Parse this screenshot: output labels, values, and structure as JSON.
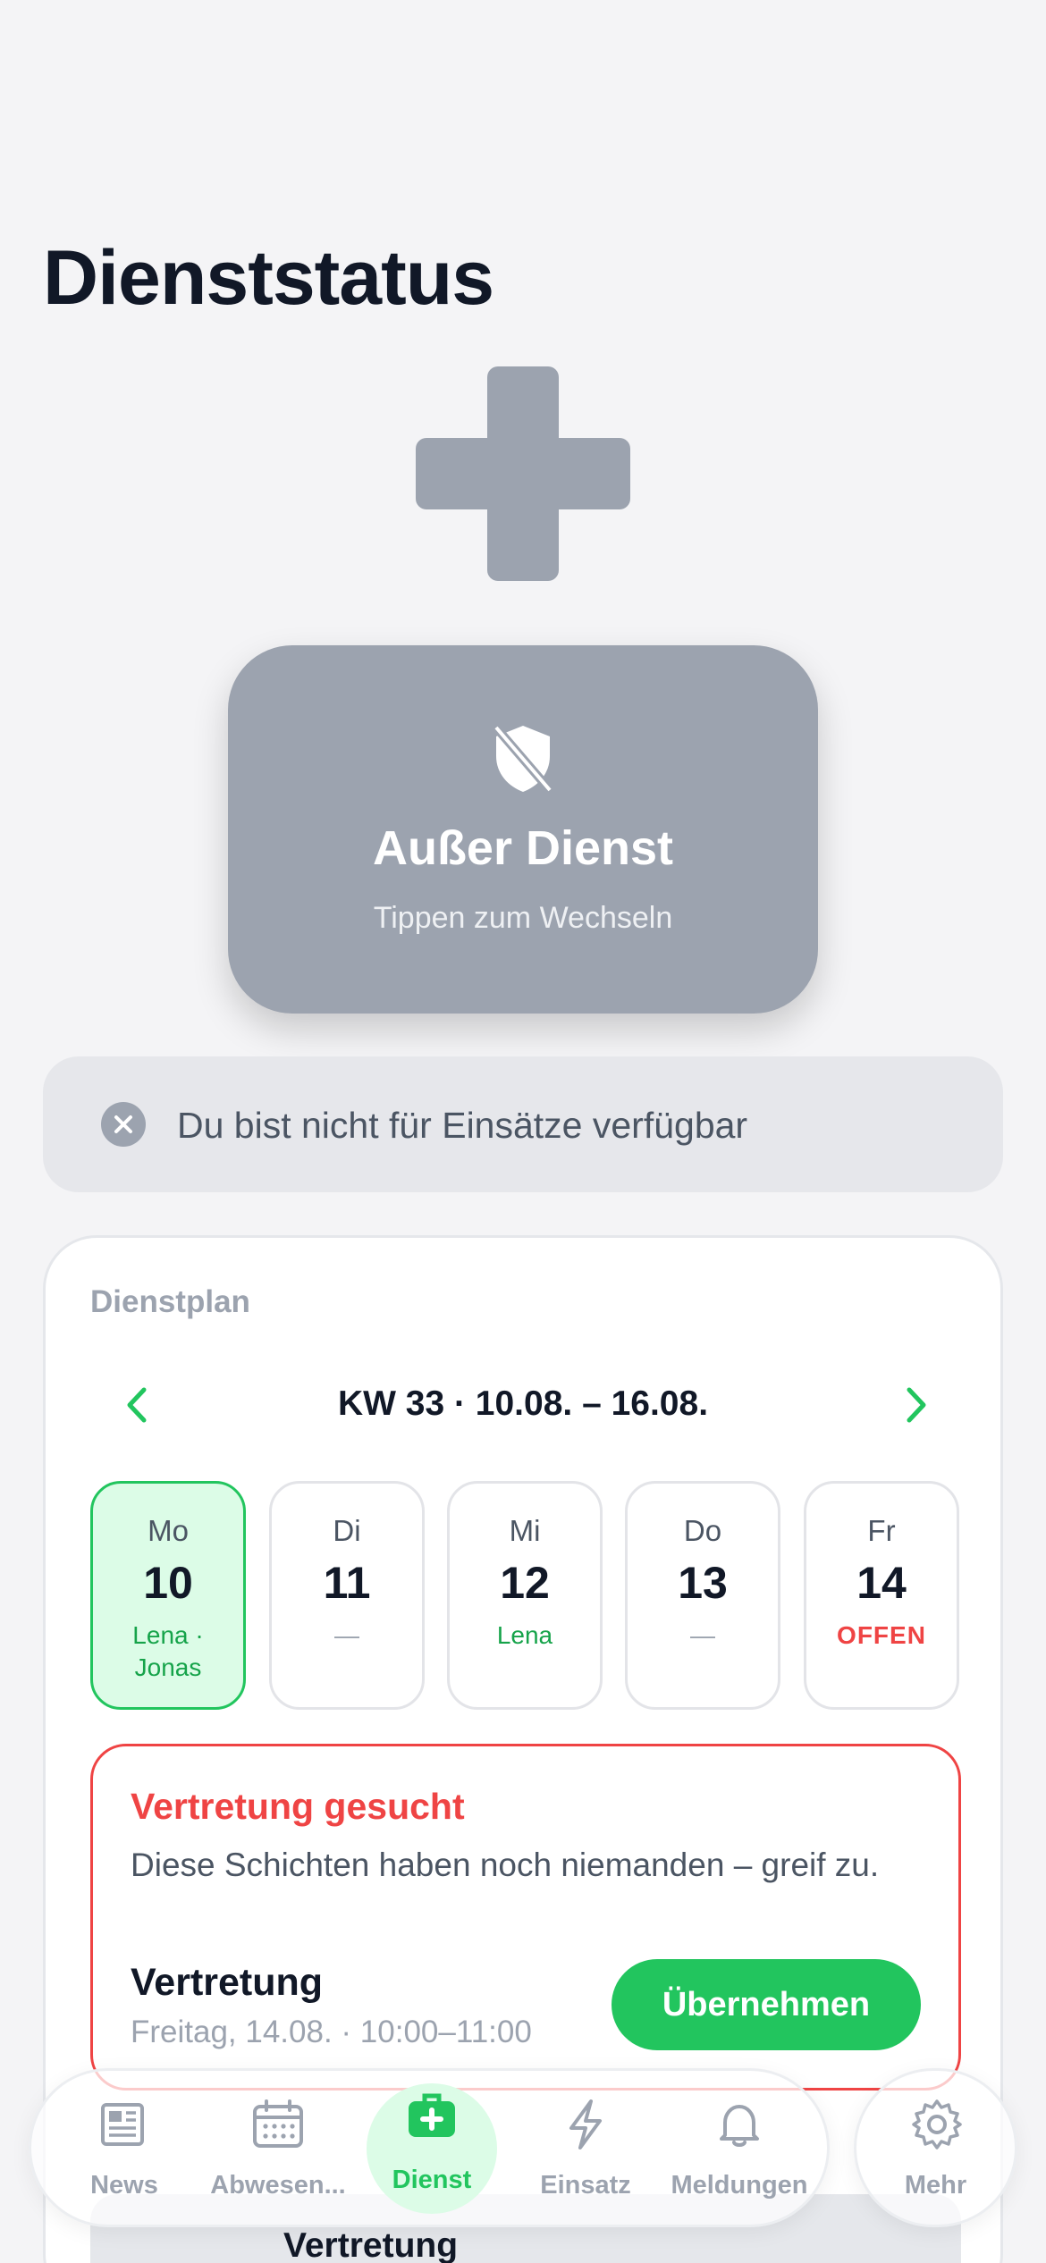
{
  "page": {
    "title": "Dienststatus"
  },
  "status": {
    "label": "Außer Dienst",
    "hint": "Tippen zum Wechseln",
    "color": "#9ca3af"
  },
  "availability": {
    "text": "Du bist nicht für Einsätze verfügbar",
    "icon": "close-circle-icon"
  },
  "schedule": {
    "label": "Dienstplan",
    "week": "KW 33 · 10.08. – 16.08.",
    "days": [
      {
        "name": "Mo",
        "num": "10",
        "sub": "Lena · Jonas",
        "state": "active"
      },
      {
        "name": "Di",
        "num": "11",
        "sub": "—",
        "state": "empty"
      },
      {
        "name": "Mi",
        "num": "12",
        "sub": "Lena",
        "state": "assigned"
      },
      {
        "name": "Do",
        "num": "13",
        "sub": "—",
        "state": "empty"
      },
      {
        "name": "Fr",
        "num": "14",
        "sub": "OFFEN",
        "state": "open"
      }
    ]
  },
  "vacancy": {
    "title": "Vertretung gesucht",
    "description": "Diese Schichten haben noch niemanden – greif zu.",
    "shift_title": "Vertretung",
    "shift_time": "Freitag, 14.08. · 10:00–11:00",
    "action_label": "Übernehmen"
  },
  "next_card": {
    "title": "Vertretung"
  },
  "tabbar": {
    "items": [
      {
        "label": "News",
        "icon": "newspaper-icon"
      },
      {
        "label": "Abwesen...",
        "icon": "calendar-icon"
      },
      {
        "label": "Dienst",
        "icon": "medkit-icon",
        "active": true
      },
      {
        "label": "Einsatz",
        "icon": "bolt-icon"
      },
      {
        "label": "Meldungen",
        "icon": "bell-icon"
      }
    ],
    "more": {
      "label": "Mehr",
      "icon": "gear-icon"
    }
  },
  "colors": {
    "accent": "#22c55e",
    "danger": "#ef4444",
    "background": "#f4f4f6"
  }
}
